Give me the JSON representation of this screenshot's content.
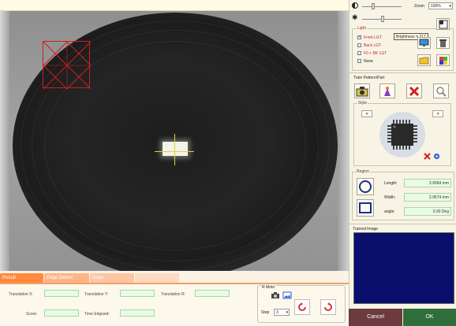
{
  "tabs": [
    {
      "label": "Result"
    },
    {
      "label": "Edge Detect"
    },
    {
      "label": "Edge"
    },
    {
      "label": ""
    }
  ],
  "results": {
    "translation_x_label": "Translation X:",
    "translation_y_label": "Translation Y:",
    "translation_r_label": "Translation R:",
    "score_label": "Score:",
    "time_elapsed_label": "Time Elapsed:"
  },
  "motor": {
    "title": "R Moto",
    "step_label": "Step",
    "step_value": "3"
  },
  "display": {
    "zoom_label": "Zoom",
    "zoom_value": "100%",
    "brightness_tooltip": "Brightness = 217"
  },
  "light": {
    "title": "Light",
    "options": [
      {
        "label": "Front LGT",
        "checked": true
      },
      {
        "label": "Back LGT",
        "checked": false
      },
      {
        "label": "F0 + BK LGT",
        "checked": false
      },
      {
        "label": "None",
        "checked": false
      }
    ]
  },
  "train": {
    "title": "Train Pattern/Part"
  },
  "style": {
    "title": "Style"
  },
  "region": {
    "title": "Region",
    "length_label": "Length:",
    "length_value": "2.9584 mm",
    "width_label": "Width:",
    "width_value": "2.9574 mm",
    "angle_label": "angle:",
    "angle_value": "0.00 Deg"
  },
  "trained_image": {
    "title": "Trained Image",
    "bg_color": "#0a0f6c"
  },
  "buttons": {
    "cancel": "Cancel",
    "ok": "OK"
  }
}
